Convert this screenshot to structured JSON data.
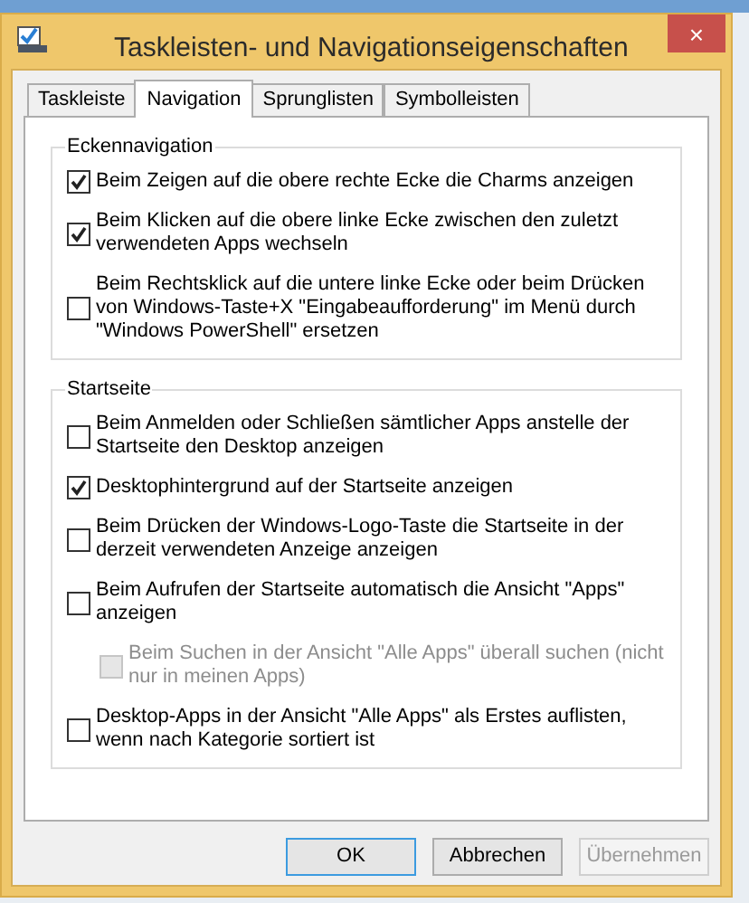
{
  "window": {
    "title": "Taskleisten- und Navigationseigenschaften",
    "close": "×"
  },
  "tabs": [
    {
      "label": "Taskleiste",
      "selected": false
    },
    {
      "label": "Navigation",
      "selected": true
    },
    {
      "label": "Sprunglisten",
      "selected": false
    },
    {
      "label": "Symbolleisten",
      "selected": false
    }
  ],
  "groups": [
    {
      "title": "Eckennavigation",
      "options": [
        {
          "label": "Beim Zeigen auf die obere rechte Ecke die Charms anzeigen",
          "checked": true,
          "disabled": false
        },
        {
          "label": "Beim Klicken auf die obere linke Ecke zwischen den zuletzt verwendeten Apps wechseln",
          "checked": true,
          "disabled": false
        },
        {
          "label": "Beim Rechtsklick auf die untere linke Ecke oder beim Drücken von Windows-Taste+X \"Eingabeaufforderung\" im Menü durch \"Windows PowerShell\" ersetzen",
          "checked": false,
          "disabled": false
        }
      ]
    },
    {
      "title": "Startseite",
      "options": [
        {
          "label": "Beim Anmelden oder Schließen sämtlicher Apps anstelle der Startseite den Desktop anzeigen",
          "checked": false,
          "disabled": false
        },
        {
          "label": "Desktophintergrund auf der Startseite anzeigen",
          "checked": true,
          "disabled": false
        },
        {
          "label": "Beim Drücken der Windows-Logo-Taste die Startseite in der derzeit verwendeten Anzeige anzeigen",
          "checked": false,
          "disabled": false
        },
        {
          "label": "Beim Aufrufen der Startseite automatisch die Ansicht \"Apps\" anzeigen",
          "checked": false,
          "disabled": false,
          "children": [
            {
              "label": "Beim Suchen in der Ansicht \"Alle Apps\" überall suchen (nicht nur in meinen Apps)",
              "checked": false,
              "disabled": true
            }
          ]
        },
        {
          "label": "Desktop-Apps in der Ansicht \"Alle Apps\" als Erstes auflisten, wenn nach Kategorie sortiert ist",
          "checked": false,
          "disabled": false
        }
      ]
    }
  ],
  "buttons": [
    {
      "label": "OK",
      "kind": "default",
      "disabled": false
    },
    {
      "label": "Abbrechen",
      "kind": "normal",
      "disabled": false
    },
    {
      "label": "Übernehmen",
      "kind": "normal",
      "disabled": true
    }
  ]
}
